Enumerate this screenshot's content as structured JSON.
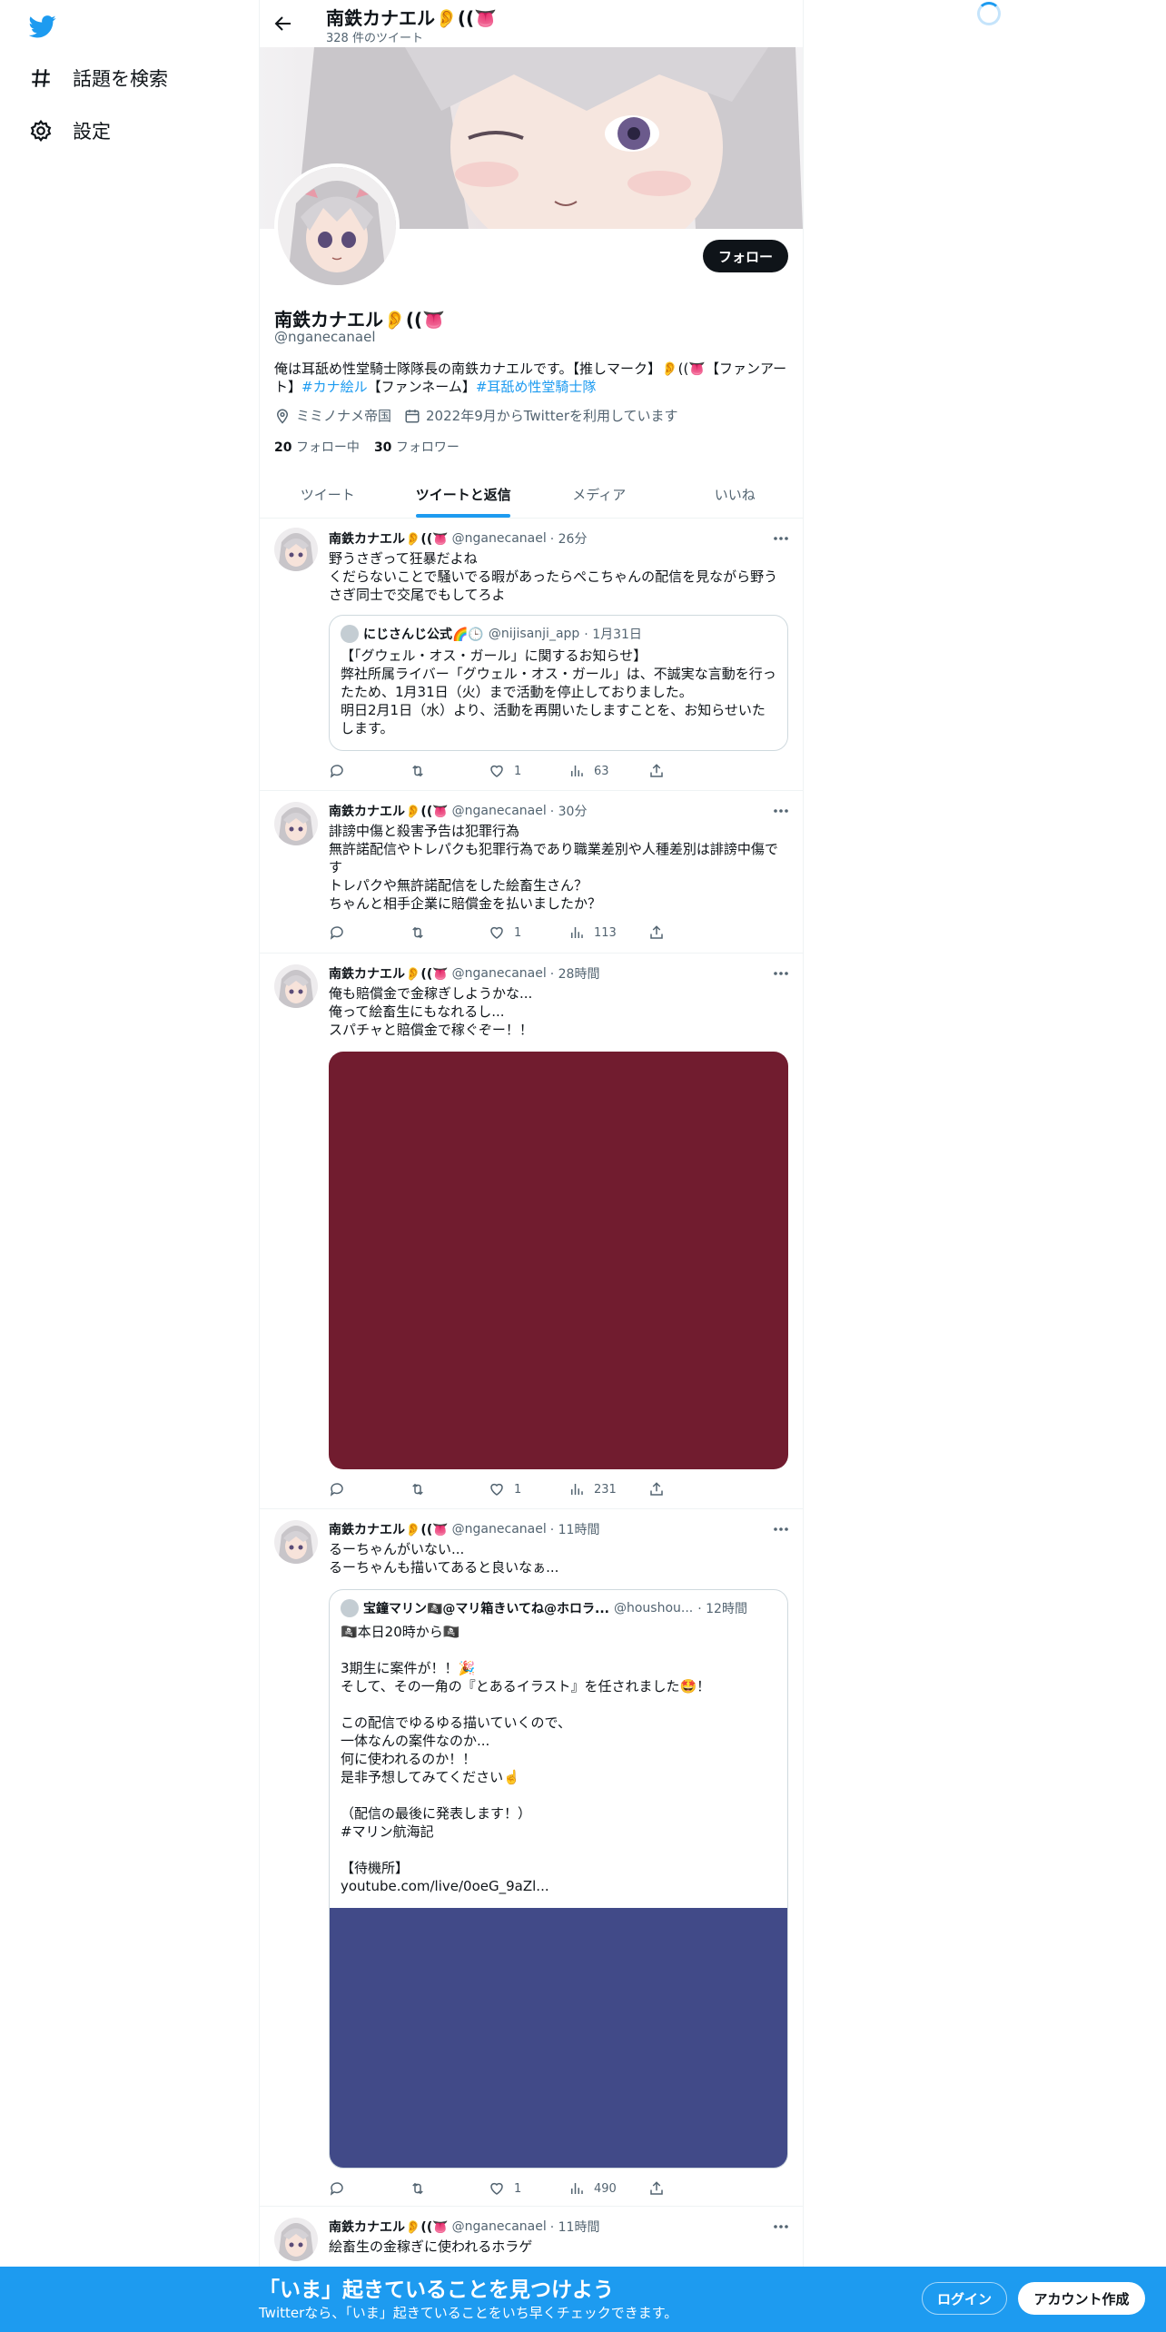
{
  "nav": {
    "explore_label": "話題を検索",
    "settings_label": "設定"
  },
  "header": {
    "title": "南鉄カナエル👂((👅",
    "tweet_count": "328 件のツイート"
  },
  "profile": {
    "name": "南鉄カナエル👂((👅",
    "handle": "@nganecanael",
    "follow_label": "フォロー",
    "bio_text": "俺は耳舐め性堂騎士隊隊長の南鉄カナエルです。【推しマーク】👂((👅【ファンアート】",
    "bio_tag1": "#カナ絵ル",
    "bio_mid": "【ファンネーム】",
    "bio_tag2": "#耳舐め性堂騎士隊",
    "location": "ミミノナメ帝国",
    "joined": "2022年9月からTwitterを利用しています",
    "following_count": "20",
    "following_label": "フォロー中",
    "followers_count": "30",
    "followers_label": "フォロワー"
  },
  "tabs": [
    {
      "label": "ツイート"
    },
    {
      "label": "ツイートと返信"
    },
    {
      "label": "メディア"
    },
    {
      "label": "いいね"
    }
  ],
  "tweets": [
    {
      "name": "南鉄カナエル👂((👅",
      "handle": "@nganecanael",
      "time": "· 26分",
      "text": "野うさぎって狂暴だよね\nくだらないことで騒いでる暇があったらぺこちゃんの配信を見ながら野うさぎ同士で交尾でもしてろよ",
      "quote": {
        "name": "にじさんじ公式🌈🕒",
        "handle": "@nijisanji_app",
        "time": "· 1月31日",
        "text": "【「グウェル・オス・ガール」に関するお知らせ】\n弊社所属ライバー「グウェル・オス・ガール」は、不誠実な言動を行ったため、1月31日（火）まで活動を停止しておりました。\n明日2月1日（水）より、活動を再開いたしますことを、お知らせいたします。"
      },
      "likes": "1",
      "views": "63"
    },
    {
      "name": "南鉄カナエル👂((👅",
      "handle": "@nganecanael",
      "time": "· 30分",
      "text": "誹謗中傷と殺害予告は犯罪行為\n無許諾配信やトレパクも犯罪行為であり職業差別や人種差別は誹謗中傷です\nトレパクや無許諾配信をした絵畜生さん？\nちゃんと相手企業に賠償金を払いましたか？",
      "likes": "1",
      "views": "113"
    },
    {
      "name": "南鉄カナエル👂((👅",
      "handle": "@nganecanael",
      "time": "· 28時間",
      "text": "俺も賠償金で金稼ぎしようかな...\n俺って絵畜生にもなれるし...\nスパチャと賠償金で稼ぐぞー！！",
      "media_color": "#711c2f",
      "likes": "1",
      "views": "231"
    },
    {
      "name": "南鉄カナエル👂((👅",
      "handle": "@nganecanael",
      "time": "· 11時間",
      "text": "るーちゃんがいない...\nるーちゃんも描いてあると良いなぁ...",
      "quote": {
        "name": "宝鐘マリン🏴‍☠️@マリ箱きいてね@ホロラ...",
        "handle": "@houshou...",
        "time": "· 12時間",
        "text": "🏴‍☠️本日20時から🏴‍☠️\n\n3期生に案件が！！🎉\nそして、その一角の『とあるイラスト』を任されました🤩！\n\nこの配信でゆるゆる描いていくので、\n一体なんの案件なのか...\n何に使われるのか！！\n是非予想してみてください☝️\n\n（配信の最後に発表します！）\n#マリン航海記\n\n【待機所】\nyoutube.com/live/0oeG_9aZl...",
        "media_color": "#414a88"
      },
      "likes": "1",
      "views": "490"
    },
    {
      "name": "南鉄カナエル👂((👅",
      "handle": "@nganecanael",
      "time": "· 11時間",
      "text": "絵畜生の金稼ぎに使われるホラゲ"
    }
  ],
  "bottom_bar": {
    "title": "「いま」起きていることを見つけよう",
    "subtitle": "Twitterなら、「いま」起きていることをいち早くチェックできます。",
    "login_label": "ログイン",
    "signup_label": "アカウント作成"
  },
  "colors": {
    "accent": "#1d9bf0",
    "text": "#0f1419",
    "muted": "#536471"
  },
  "icons": [
    "twitter-bird-icon",
    "hashtag-icon",
    "gear-icon",
    "back-arrow-icon",
    "location-icon",
    "calendar-icon",
    "more-icon",
    "reply-icon",
    "retweet-icon",
    "like-icon",
    "views-icon",
    "share-icon"
  ]
}
